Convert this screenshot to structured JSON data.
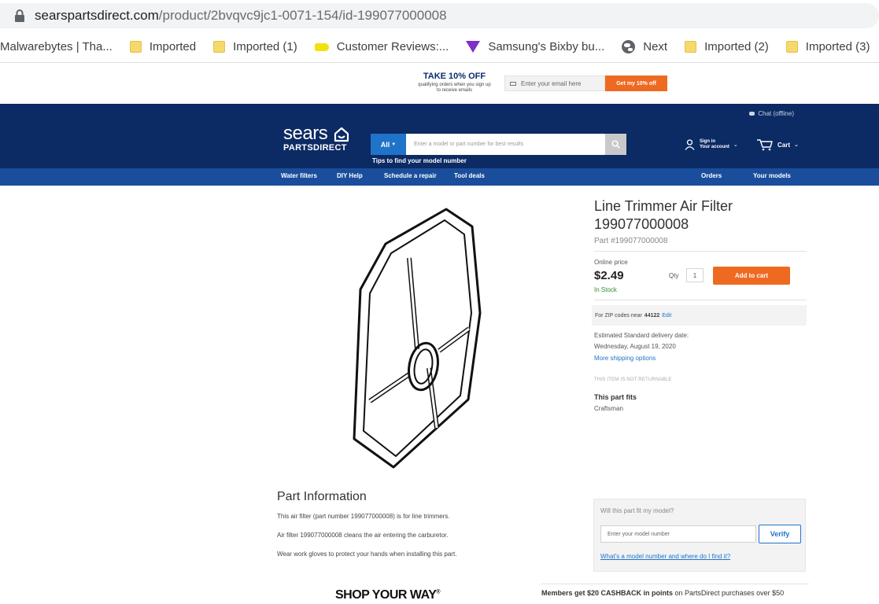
{
  "browser": {
    "url_host": "searspartsdirect.com",
    "url_path": "/product/2bvqvc9jc1-0071-154/id-199077000008",
    "bookmarks": [
      {
        "label": "Malwarebytes | Tha...",
        "icon": "none"
      },
      {
        "label": "Imported",
        "icon": "folder-icon"
      },
      {
        "label": "Imported (1)",
        "icon": "folder-icon"
      },
      {
        "label": "Customer Reviews:...",
        "icon": "tag-icon"
      },
      {
        "label": "Samsung's Bixby bu...",
        "icon": "triangle-icon"
      },
      {
        "label": "Next",
        "icon": "globe-icon"
      },
      {
        "label": "Imported (2)",
        "icon": "folder-icon"
      },
      {
        "label": "Imported (3)",
        "icon": "folder-icon"
      }
    ]
  },
  "promo": {
    "title": "TAKE 10% OFF",
    "subtitle": "qualifying orders when you sign up to receive emails",
    "email_placeholder": "Enter your email here",
    "button": "Get my 10% off"
  },
  "header": {
    "chat": "Chat (offline)",
    "logo_word": "sears",
    "logo_sub": "PARTSDIRECT",
    "search_category": "All",
    "search_placeholder": "Enter a model or part number for best results",
    "tips": "Tips to find your model number",
    "sign_in": "Sign in",
    "account": "Your account",
    "cart": "Cart"
  },
  "nav": {
    "items": [
      "Water filters",
      "DIY Help",
      "Schedule a repair",
      "Tool deals",
      "Orders",
      "Your models"
    ]
  },
  "product": {
    "title_line1": "Line Trimmer Air Filter",
    "title_line2": "199077000008",
    "part_number": "Part #199077000008",
    "online_price_label": "Online price",
    "price": "$2.49",
    "stock": "In Stock",
    "qty_label": "Qty",
    "qty_value": "1",
    "add_to_cart": "Add to cart",
    "zip_prefix": "For ZIP codes near",
    "zip": "44122",
    "zip_edit": "Edit",
    "delivery_label": "Estimated Standard delivery date:",
    "delivery_date": "Wednesday, August 19, 2020",
    "more_shipping": "More shipping options",
    "not_returnable": "THIS ITEM IS NOT RETURNABLE",
    "fits_label": "This part fits",
    "fits_brand": "Craftsman"
  },
  "part_info": {
    "title": "Part Information",
    "lines": [
      "This air filter (part number 199077000008) is for line trimmers.",
      "Air filter 199077000008 cleans the air entering the carburetor.",
      "Wear work gloves to protect your hands when installing this part."
    ]
  },
  "fit_check": {
    "question": "Will this part fit my model?",
    "placeholder": "Enter your model number",
    "verify": "Verify",
    "help_link": "What's a model number and where do I find it?"
  },
  "footer": {
    "shop_your_way": "SHOP YOUR WAY",
    "members_bold": "Members get $20 CASHBACK in points",
    "members_rest": " on PartsDirect purchases over $50"
  },
  "colors": {
    "header_navy": "#0c2a63",
    "nav_blue": "#1a4e9c",
    "accent_orange": "#ef6a21",
    "link_blue": "#1f73c9",
    "in_stock_green": "#2e8b2e"
  }
}
